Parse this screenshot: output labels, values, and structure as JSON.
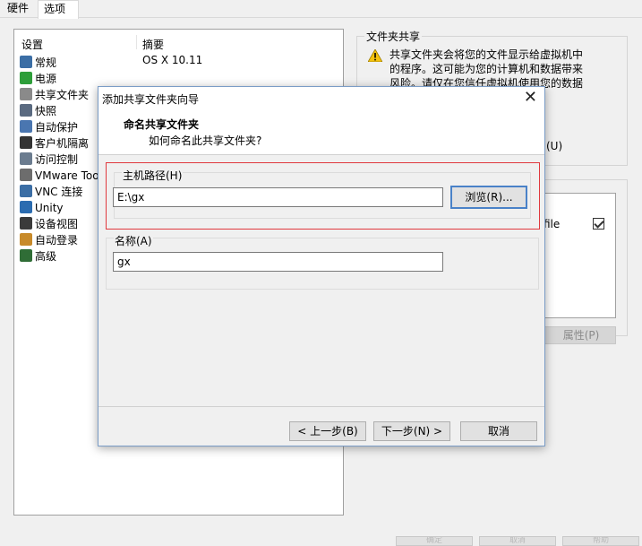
{
  "tabs": {
    "hardware": "硬件",
    "options": "选项"
  },
  "settings": {
    "headers": {
      "setting": "设置",
      "summary": "摘要"
    },
    "items": [
      {
        "label": "常规",
        "icon": "monitor-icon",
        "color": "#3b6ea5"
      },
      {
        "label": "电源",
        "icon": "play-icon",
        "color": "#2e9e3a"
      },
      {
        "label": "共享文件夹",
        "icon": "shared-folder-icon",
        "color": "#8a8a8a"
      },
      {
        "label": "快照",
        "icon": "snapshot-icon",
        "color": "#5a6a80"
      },
      {
        "label": "自动保护",
        "icon": "autoprotect-icon",
        "color": "#4a76b0"
      },
      {
        "label": "客户机隔离",
        "icon": "isolation-icon",
        "color": "#333333"
      },
      {
        "label": "访问控制",
        "icon": "access-control-icon",
        "color": "#6b7c8f"
      },
      {
        "label": "VMware Too",
        "icon": "vmware-tools-icon",
        "color": "#6d6d6d"
      },
      {
        "label": "VNC 连接",
        "icon": "vnc-icon",
        "color": "#3b6ea5"
      },
      {
        "label": "Unity",
        "icon": "unity-icon",
        "color": "#2b6cb0"
      },
      {
        "label": "设备视图",
        "icon": "device-view-icon",
        "color": "#3a3a3a"
      },
      {
        "label": "自动登录",
        "icon": "autologin-icon",
        "color": "#c88a2a"
      },
      {
        "label": "高级",
        "icon": "advanced-icon",
        "color": "#2f6d36"
      }
    ],
    "first_summary": "OS X 10.11"
  },
  "share_panel": {
    "legend": "文件夹共享",
    "warning_lines": [
      "共享文件夹会将您的文件显示给虚拟机中",
      "的程序。这可能为您的计算机和数据带来",
      "风险。请仅在您信任虚拟机使用您的数据"
    ],
    "u_tail": "(U)",
    "file_tail": "file",
    "properties_button": "属性(P)"
  },
  "dialog": {
    "title": "添加共享文件夹向导",
    "heading": "命名共享文件夹",
    "subheading": "如何命名此共享文件夹?",
    "host_path_label": "主机路径(H)",
    "host_path_value": "E:\\gx",
    "browse_button": "浏览(R)...",
    "name_label": "名称(A)",
    "name_value": "gx",
    "back_button": "< 上一步(B)",
    "next_button": "下一步(N) >",
    "cancel_button": "取消",
    "highlight_color": "#e0393e"
  },
  "bottom_buttons": [
    "确定",
    "取消",
    "帮助"
  ]
}
